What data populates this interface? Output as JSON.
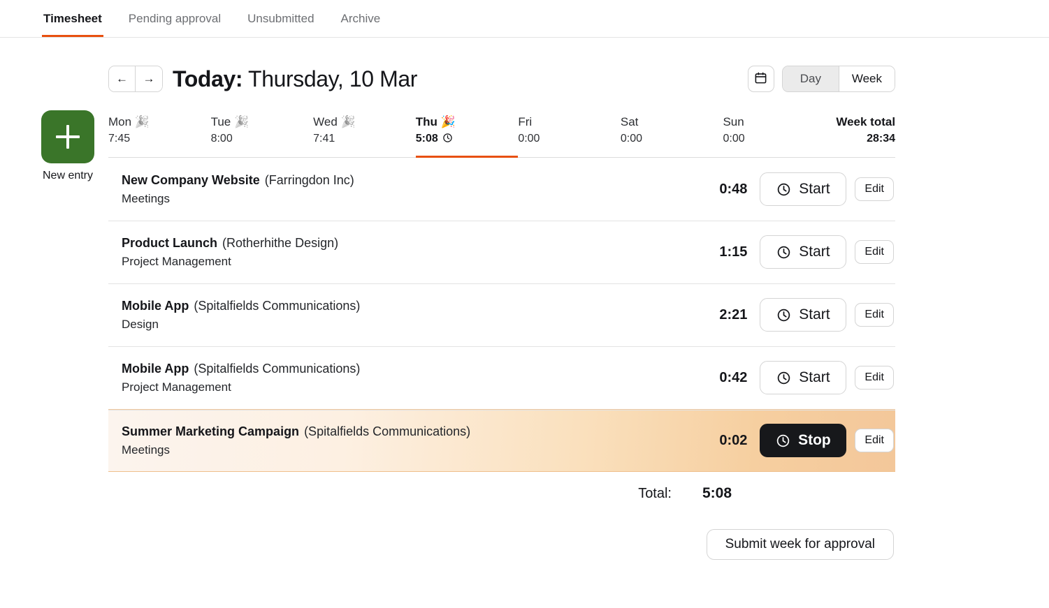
{
  "tabs": [
    {
      "label": "Timesheet",
      "active": true
    },
    {
      "label": "Pending approval",
      "active": false
    },
    {
      "label": "Unsubmitted",
      "active": false
    },
    {
      "label": "Archive",
      "active": false
    }
  ],
  "rail": {
    "new_entry_label": "New entry",
    "plus_icon": "plus-icon",
    "green": "#3a7529"
  },
  "header": {
    "prev_label": "←",
    "next_label": "→",
    "title_prefix": "Today:",
    "title_date": "Thursday, 10 Mar",
    "calendar_icon": "calendar-icon",
    "view_day": "Day",
    "view_week": "Week",
    "view_selected": "Week"
  },
  "week": {
    "days": [
      {
        "name": "Mon",
        "emoji": "🎉",
        "emoji_dim": true,
        "value": "7:45",
        "today": false,
        "running": false
      },
      {
        "name": "Tue",
        "emoji": "🎉",
        "emoji_dim": true,
        "value": "8:00",
        "today": false,
        "running": false
      },
      {
        "name": "Wed",
        "emoji": "🎉",
        "emoji_dim": true,
        "value": "7:41",
        "today": false,
        "running": false
      },
      {
        "name": "Thu",
        "emoji": "🎉",
        "emoji_dim": false,
        "value": "5:08",
        "today": true,
        "running": true
      },
      {
        "name": "Fri",
        "emoji": "",
        "emoji_dim": false,
        "value": "0:00",
        "today": false,
        "running": false
      },
      {
        "name": "Sat",
        "emoji": "",
        "emoji_dim": false,
        "value": "0:00",
        "today": false,
        "running": false
      },
      {
        "name": "Sun",
        "emoji": "",
        "emoji_dim": false,
        "value": "0:00",
        "today": false,
        "running": false
      }
    ],
    "total_label": "Week total",
    "total_value": "28:34"
  },
  "entries": [
    {
      "project": "New Company Website",
      "client": "(Farringdon Inc)",
      "task": "Meetings",
      "duration": "0:48",
      "action_label": "Start",
      "running": false,
      "edit_label": "Edit"
    },
    {
      "project": "Product Launch",
      "client": "(Rotherhithe Design)",
      "task": "Project Management",
      "duration": "1:15",
      "action_label": "Start",
      "running": false,
      "edit_label": "Edit"
    },
    {
      "project": "Mobile App",
      "client": "(Spitalfields Communications)",
      "task": "Design",
      "duration": "2:21",
      "action_label": "Start",
      "running": false,
      "edit_label": "Edit"
    },
    {
      "project": "Mobile App",
      "client": "(Spitalfields Communications)",
      "task": "Project Management",
      "duration": "0:42",
      "action_label": "Start",
      "running": false,
      "edit_label": "Edit"
    },
    {
      "project": "Summer Marketing Campaign",
      "client": "(Spitalfields Communications)",
      "task": "Meetings",
      "duration": "0:02",
      "action_label": "Stop",
      "running": true,
      "edit_label": "Edit"
    }
  ],
  "footer": {
    "total_label": "Total:",
    "total_value": "5:08",
    "submit_label": "Submit week for approval"
  },
  "colors": {
    "accent_orange": "#e8500f",
    "new_entry_green": "#3a7529",
    "running_row_start": "#fcf4ee",
    "running_row_end": "#f3c79a",
    "stop_button": "#17181b"
  }
}
